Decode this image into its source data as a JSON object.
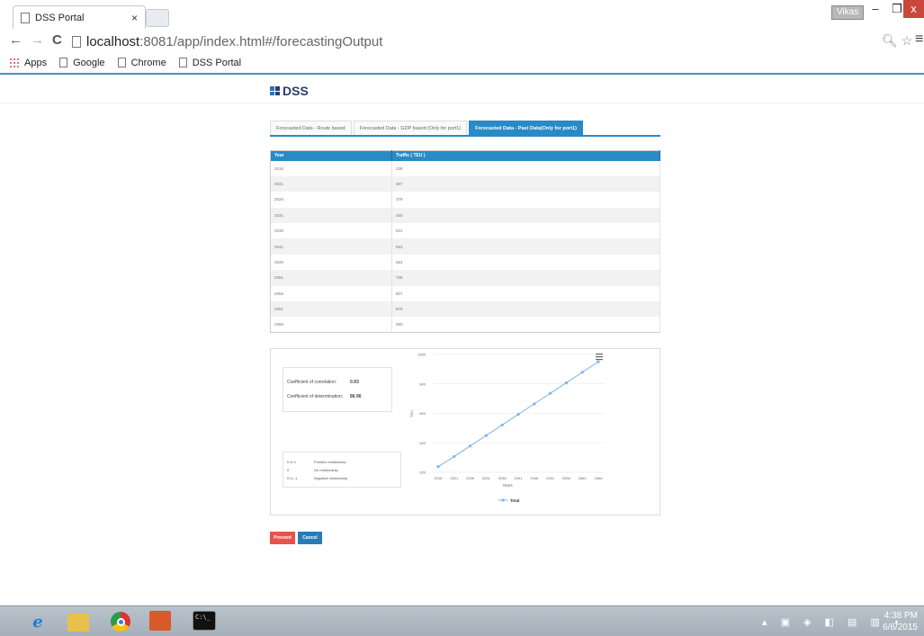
{
  "browser": {
    "tab_title": "DSS Portal",
    "tab_close": "×",
    "user_name": "Vikas",
    "window_min": "–",
    "window_max": "❐",
    "window_close": "x",
    "url_host": "localhost",
    "url_rest": ":8081/app/index.html#/forecastingOutput",
    "bookmarks": [
      "Apps",
      "Google",
      "Chrome",
      "DSS Portal"
    ]
  },
  "page": {
    "brand": "DSS",
    "tabs": [
      "Forecasted Data - Route based",
      "Forecasted Data - GDP based (Only for port1)",
      "Forecasted Data - Past Data(Only for port1)"
    ],
    "table": {
      "headers": [
        "Year",
        "Traffic ( TEU )"
      ],
      "rows": [
        [
          "2016",
          "238"
        ],
        [
          "2021",
          "307"
        ],
        [
          "2026",
          "379"
        ],
        [
          "2031",
          "450"
        ],
        [
          "2036",
          "521"
        ],
        [
          "2041",
          "593"
        ],
        [
          "2046",
          "664"
        ],
        [
          "2051",
          "736"
        ],
        [
          "2056",
          "807"
        ],
        [
          "2061",
          "879"
        ],
        [
          "2066",
          "950"
        ]
      ]
    },
    "coefficients": {
      "correlation_label": "Coefficient of correlation:",
      "correlation_value": "0.93",
      "determination_label": "Coefficient of determination:",
      "determination_value": "86.96"
    },
    "legend_rows": [
      [
        "0 to 1",
        "Positive relationship"
      ],
      [
        "0",
        "No relationship"
      ],
      [
        "0 to -1",
        "Negative relationship"
      ]
    ],
    "buttons": {
      "proceed": "Proceed",
      "cancel": "Cancel"
    }
  },
  "chart_data": {
    "type": "line",
    "x": [
      "2016",
      "2021",
      "2026",
      "2031",
      "2036",
      "2041",
      "2046",
      "2051",
      "2056",
      "2061",
      "2066"
    ],
    "series": [
      {
        "name": "Total",
        "values": [
          238,
          307,
          379,
          450,
          521,
          593,
          664,
          736,
          807,
          879,
          950
        ]
      }
    ],
    "xlabel": "Years",
    "ylabel": "TEU",
    "ylim": [
      200,
      1000
    ],
    "yticks": [
      200,
      400,
      600,
      800,
      1000
    ],
    "grid": true,
    "legend": "bottom",
    "color": "#7cb5ec"
  },
  "taskbar": {
    "cmd_label": "C:\\_",
    "time": "4:38 PM",
    "date": "6/6/2015"
  }
}
